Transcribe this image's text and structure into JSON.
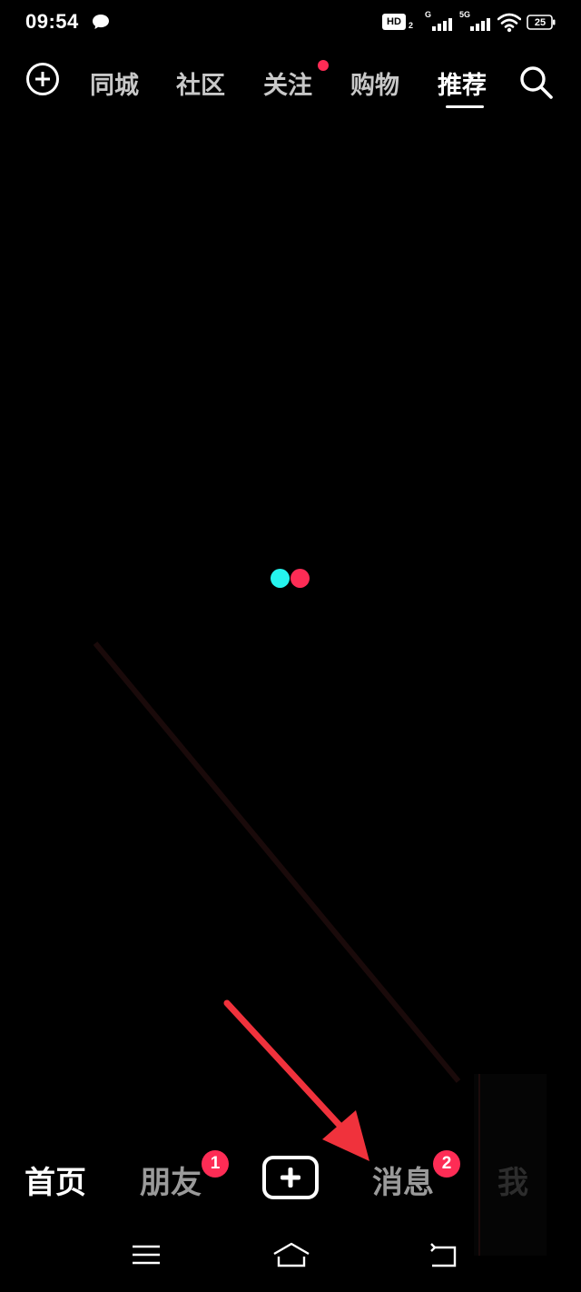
{
  "status_bar": {
    "time": "09:54",
    "chat_icon": "chat-bubble-icon",
    "hd_label": "HD",
    "hd_sub": "2",
    "signal_1_label": "G",
    "signal_2_label": "5G",
    "wifi_icon": "wifi-icon",
    "battery_level": "25"
  },
  "top_nav": {
    "plus_icon": "plus-circle-icon",
    "tabs": [
      {
        "label": "同城",
        "active": false
      },
      {
        "label": "社区",
        "active": false
      },
      {
        "label": "关注",
        "active": false,
        "has_dot": true
      },
      {
        "label": "购物",
        "active": false
      },
      {
        "label": "推荐",
        "active": true
      }
    ],
    "search_icon": "search-icon"
  },
  "loading": {
    "colors": [
      "#25f4ee",
      "#fe2c55"
    ]
  },
  "bottom_bar": {
    "tabs": [
      {
        "label": "首页",
        "active": true
      },
      {
        "label": "朋友",
        "badge": "1"
      },
      {
        "label": "",
        "type": "create-button"
      },
      {
        "label": "消息",
        "badge": "2"
      },
      {
        "label": "我"
      }
    ]
  },
  "system_nav": {
    "menu_icon": "menu-icon",
    "home_icon": "home-icon",
    "back_icon": "back-icon"
  },
  "colors": {
    "accent_red": "#fe2c55",
    "accent_cyan": "#25f4ee",
    "annotation_arrow": "#f0323c"
  }
}
